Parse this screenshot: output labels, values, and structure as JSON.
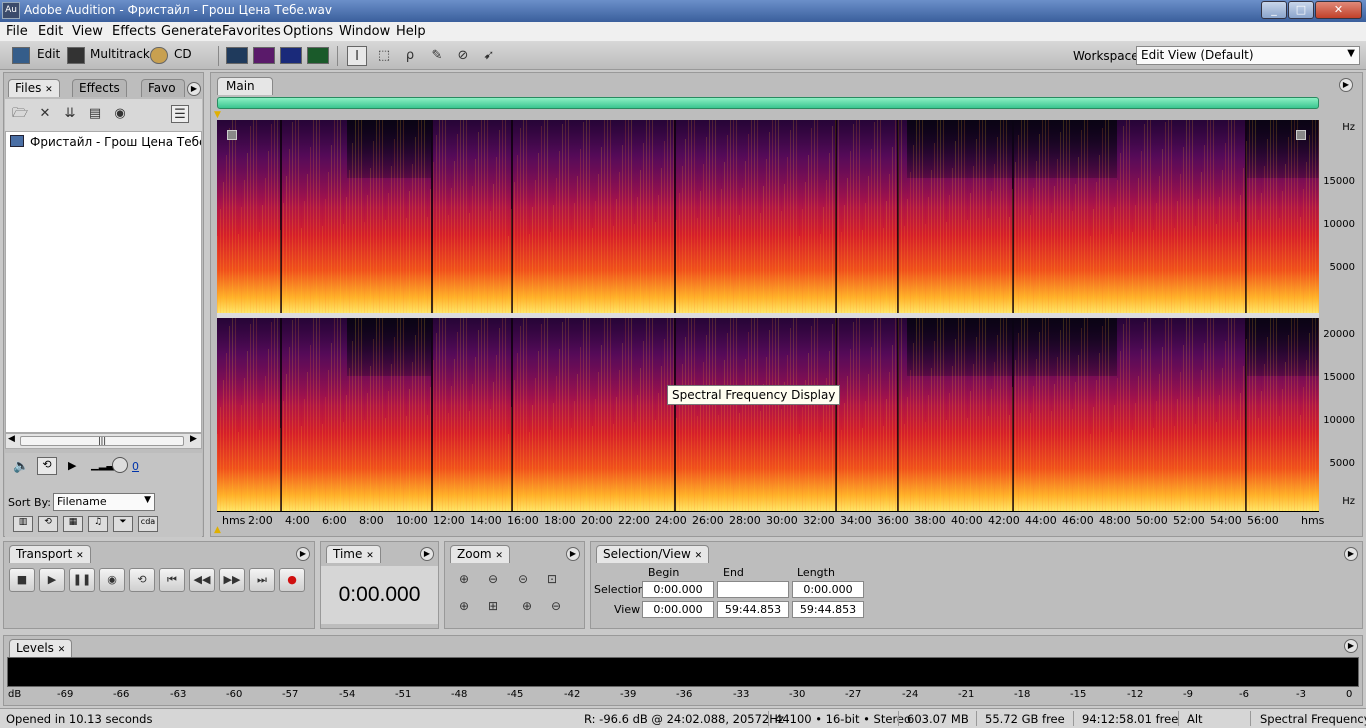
{
  "window": {
    "title": "Adobe Audition - Фристайл - Грош Цена Тебе.wav",
    "app_icon": "Au",
    "min": "_",
    "max": "□",
    "close": "✕"
  },
  "menu": [
    "File",
    "Edit",
    "View",
    "Effects",
    "Generate",
    "Favorites",
    "Options",
    "Window",
    "Help"
  ],
  "toolbar": {
    "edit_label": "Edit",
    "multitrack_label": "Multitrack",
    "cd_label": "CD",
    "workspace_label": "Workspace:",
    "workspace_value": "Edit View (Default)"
  },
  "files_panel": {
    "tabs": [
      "Files",
      "Effects",
      "Favo"
    ],
    "file_name": "Фристайл - Грош Цена Тебе.wav",
    "sort_label": "Sort By:",
    "sort_value": "Filename",
    "pan_value": "0"
  },
  "main_panel": {
    "tab": "Main",
    "tooltip": "Spectral Frequency Display",
    "freq_labels_top": [
      "Hz",
      "15000",
      "10000",
      "5000"
    ],
    "freq_labels_bottom": [
      "20000",
      "15000",
      "10000",
      "5000",
      "Hz"
    ],
    "time_labels": [
      "hms",
      "2:00",
      "4:00",
      "6:00",
      "8:00",
      "10:00",
      "12:00",
      "14:00",
      "16:00",
      "18:00",
      "20:00",
      "22:00",
      "24:00",
      "26:00",
      "28:00",
      "30:00",
      "32:00",
      "34:00",
      "36:00",
      "38:00",
      "40:00",
      "42:00",
      "44:00",
      "46:00",
      "48:00",
      "50:00",
      "52:00",
      "54:00",
      "56:00",
      "hms"
    ]
  },
  "transport": {
    "tab": "Transport"
  },
  "time_panel": {
    "tab": "Time",
    "value": "0:00.000"
  },
  "zoom_panel": {
    "tab": "Zoom"
  },
  "selection_view": {
    "tab": "Selection/View",
    "headers": [
      "Begin",
      "End",
      "Length"
    ],
    "rows": [
      {
        "label": "Selection",
        "begin": "0:00.000",
        "end": "",
        "length": "0:00.000"
      },
      {
        "label": "View",
        "begin": "0:00.000",
        "end": "59:44.853",
        "length": "59:44.853"
      }
    ]
  },
  "levels": {
    "tab": "Levels",
    "labels": [
      "dB",
      "-69",
      "-66",
      "-63",
      "-60",
      "-57",
      "-54",
      "-51",
      "-48",
      "-45",
      "-42",
      "-39",
      "-36",
      "-33",
      "-30",
      "-27",
      "-24",
      "-21",
      "-18",
      "-15",
      "-12",
      "-9",
      "-6",
      "-3",
      "0"
    ]
  },
  "status": {
    "opened": "Opened in 10.13 seconds",
    "cursor": "R: -96.6 dB @  24:02.088, 20572Hz",
    "format": "44100 • 16-bit • Stereo",
    "size": "603.07 MB",
    "free": "55.72 GB free",
    "time_free": "94:12:58.01 free",
    "alt": "Alt",
    "view_mode": "Spectral Frequency"
  }
}
